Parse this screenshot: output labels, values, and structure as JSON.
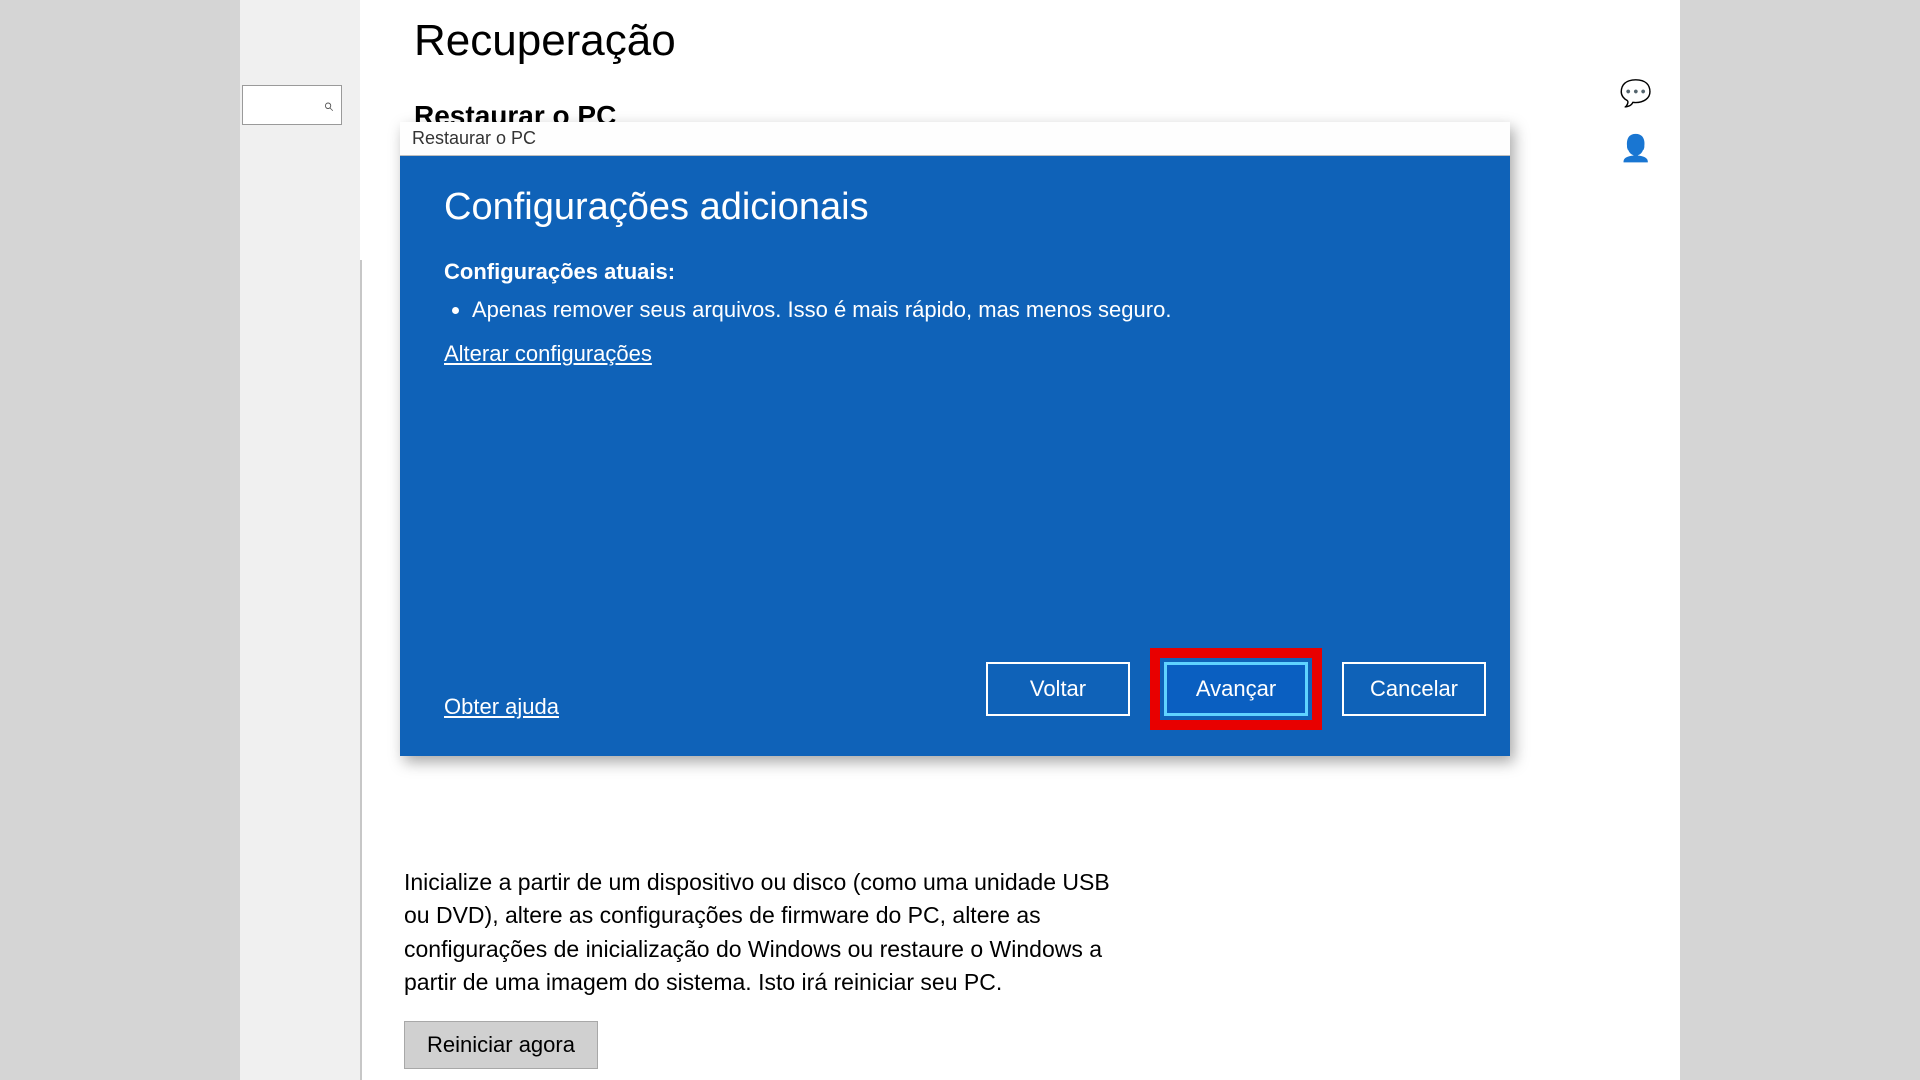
{
  "page": {
    "title": "Recuperação",
    "section_title": "Restaurar o PC",
    "below_text": "Inicialize a partir de um dispositivo ou disco (como uma unidade USB ou DVD), altere as configurações de firmware do PC, altere as configurações de inicialização do Windows ou restaure o Windows a partir de uma imagem do sistema. Isto irá reiniciar seu PC.",
    "restart_button": "Reiniciar agora"
  },
  "dialog": {
    "window_title": "Restaurar o PC",
    "heading": "Configurações adicionais",
    "current_label": "Configurações atuais:",
    "bullets": [
      "Apenas remover seus arquivos. Isso é mais rápido, mas menos seguro."
    ],
    "change_link": "Alterar configurações",
    "help_link": "Obter ajuda",
    "buttons": {
      "back": "Voltar",
      "next": "Avançar",
      "cancel": "Cancelar"
    }
  },
  "colors": {
    "dialog_bg": "#0f62b8",
    "highlight": "#e80000"
  }
}
